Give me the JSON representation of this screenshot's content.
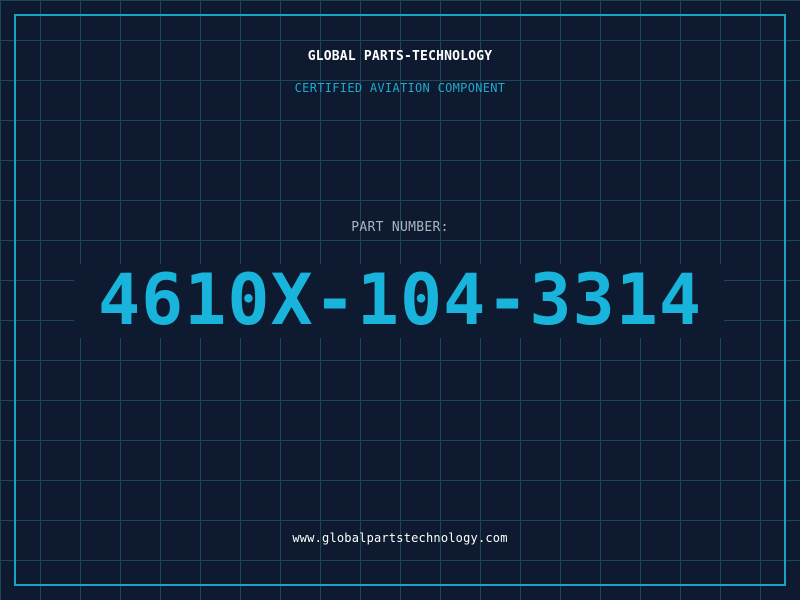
{
  "brand": {
    "company_name": "GLOBAL PARTS-TECHNOLOGY",
    "tagline": "CERTIFIED AVIATION COMPONENT"
  },
  "part": {
    "label": "PART NUMBER:",
    "number": "4610X-104-3314"
  },
  "footer": {
    "website": "www.globalpartstechnology.com"
  },
  "colors": {
    "background": "#0e1a2f",
    "grid_line": "#1d4658",
    "frame_border": "#19a3c7",
    "accent": "#19b4dc",
    "tagline": "#1fa8d1",
    "label": "#aab4c2",
    "text_primary": "#ffffff"
  }
}
